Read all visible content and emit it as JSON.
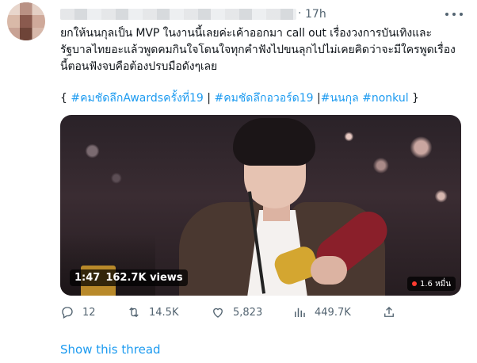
{
  "tweet": {
    "time": "17h",
    "separator": "·",
    "body_lines": [
      "ยกให้นนกุลเป็น MVP ในงานนี้เลยค่ะเค้าออกมา call out เรื่องวงการบันเทิงและ",
      "รัฐบาลไทยอะแล้วพูดคมกินใจโดนใจทุกคำฟังไปขนลุกไปไม่เคยคิดว่าจะมีใครพูดเรื่อง",
      "นี้ตอนฟังจบคือต้องปรบมือดังๆเลย"
    ],
    "hashtags": {
      "open": "{",
      "close": "}",
      "separator": "|",
      "tags": [
        "#คมชัดลึกAwardsครั้งที่19",
        "#คมชัดลึกอวอร์ด19",
        "#นนกุล",
        "#nonkul"
      ]
    },
    "video": {
      "duration": "1:47",
      "views": "162.7K views",
      "live_views": "1.6 หมื่น"
    },
    "actions": {
      "replies": "12",
      "retweets": "14.5K",
      "likes": "5,823",
      "view_count": "449.7K"
    },
    "show_thread": "Show this thread"
  },
  "icons": {
    "more": "more-horizontal-icon",
    "reply": "reply-icon",
    "retweet": "retweet-icon",
    "like": "heart-icon",
    "views": "bar-chart-icon",
    "share": "share-icon"
  },
  "colors": {
    "link": "#1d9bf0",
    "text": "#0f1419",
    "muted": "#536471"
  }
}
